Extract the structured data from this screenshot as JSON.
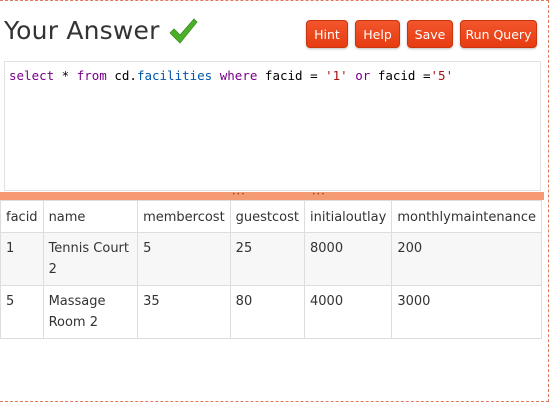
{
  "header": {
    "title": "Your Answer",
    "status_icon": "checkmark-icon",
    "accent_color": "#e8441a",
    "check_color": "#4caf2a"
  },
  "toolbar": {
    "hint_label": "Hint",
    "help_label": "Help",
    "save_label": "Save",
    "run_label": "Run Query"
  },
  "editor": {
    "tokens": {
      "t1": "select",
      "t2": " * ",
      "t3": "from",
      "t4": " cd.",
      "t5": "facilities",
      "t6": " ",
      "t7": "where",
      "t8": " facid = ",
      "t9": "'1'",
      "t10": " ",
      "t11": "or",
      "t12": " facid =",
      "t13": "'5'"
    }
  },
  "results": {
    "columns": [
      "facid",
      "name",
      "membercost",
      "guestcost",
      "initialoutlay",
      "monthlymaintenance"
    ],
    "rows": [
      [
        "1",
        "Tennis Court 2",
        "5",
        "25",
        "8000",
        "200"
      ],
      [
        "5",
        "Massage Room 2",
        "35",
        "80",
        "4000",
        "3000"
      ]
    ]
  }
}
